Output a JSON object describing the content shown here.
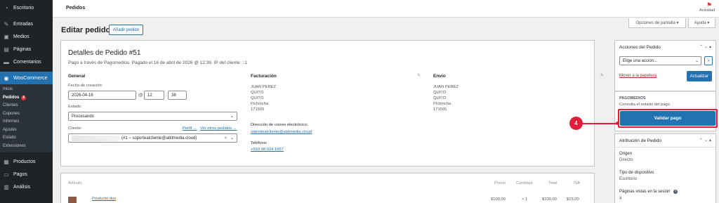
{
  "sidebar": {
    "items": [
      {
        "label": "Escritorio",
        "icon": "dashboard-icon"
      },
      {
        "label": "Entradas",
        "icon": "pin-icon"
      },
      {
        "label": "Medios",
        "icon": "media-icon"
      },
      {
        "label": "Páginas",
        "icon": "page-icon"
      },
      {
        "label": "Comentarios",
        "icon": "comment-icon"
      },
      {
        "label": "WooCommerce",
        "icon": "woocommerce-icon"
      }
    ],
    "woo_submenu": [
      "Inicio",
      "Pedidos",
      "Clientes",
      "Cupones",
      "Informes",
      "Ajustes",
      "Estado",
      "Extensiones"
    ],
    "orders_badge": "6",
    "bottom_items": [
      {
        "label": "Productos",
        "icon": "product-icon"
      },
      {
        "label": "Pagos",
        "icon": "payment-icon"
      },
      {
        "label": "Análisis",
        "icon": "analytics-icon"
      }
    ]
  },
  "topbar": {
    "page_name": "Pedidos",
    "activity_label": "Actividad",
    "screen_options": "Opciones de pantalla ▾",
    "help": "Ayuda ▾"
  },
  "title": {
    "text": "Editar pedido",
    "add_button": "Añadir pedido"
  },
  "order": {
    "heading": "Detalles de Pedido #51",
    "subtitle": "Pago a través de Pagomedios. Pagado el 16 de abril de 2026 @ 12:39. IP del cliente: ::1",
    "general": {
      "heading": "General",
      "date_label": "Fecha de creación:",
      "date": "2026-04-16",
      "at": "@",
      "hour": "12",
      "minute": "38",
      "status_label": "Estado:",
      "status": "Procesando",
      "customer_label": "Cliente:",
      "profile_link": "Perfil →",
      "other_orders_link": "Ver otros pedidos →",
      "customer_value": "(#1 – soportealcliente@abitmedia.cloud)"
    },
    "billing": {
      "heading": "Facturación",
      "lines": [
        "JUAN PEREZ",
        "QUITO",
        "QUITO",
        "Pichincha",
        "171505"
      ],
      "email_label": "Dirección de correo electrónico:",
      "email": "soportealcliente@abitmedia.cloud",
      "phone_label": "Teléfono:",
      "phone": "+593 98 024 1557"
    },
    "shipping": {
      "heading": "Envío",
      "lines": [
        "JUAN PEREZ",
        "QUITO",
        "QUITO",
        "Pichincha",
        "171505"
      ]
    }
  },
  "items": {
    "headers": [
      "Artículo",
      "Precio",
      "Cantidad",
      "Total",
      "IVA"
    ],
    "row": {
      "name": "Producto dos",
      "price": "$100,00",
      "qty": "× 1",
      "total": "$100,00",
      "tax": "$15,00"
    }
  },
  "actions": {
    "title": "Acciones del Pedido",
    "select": "Elige una acción...",
    "go": ">",
    "trash": "Mover a la papelera",
    "update": "Actualizar"
  },
  "pagomedios": {
    "title": "PAGOMEDIOS",
    "text": "Consulta el estado del pago.",
    "button": "Validar pago",
    "callout": "4"
  },
  "attribution": {
    "title": "Atribución de Pedido",
    "origin_label": "Origen",
    "origin": "Directo",
    "device_label": "Tipo de dispositivo",
    "device": "Escritorio",
    "pages_label": "Páginas vistas en la sesión",
    "pages": "4"
  },
  "colors": {
    "sidebar_bg": "#1d2327",
    "accent": "#2271b1",
    "callout": "#e01e3c",
    "badge": "#d63638"
  }
}
